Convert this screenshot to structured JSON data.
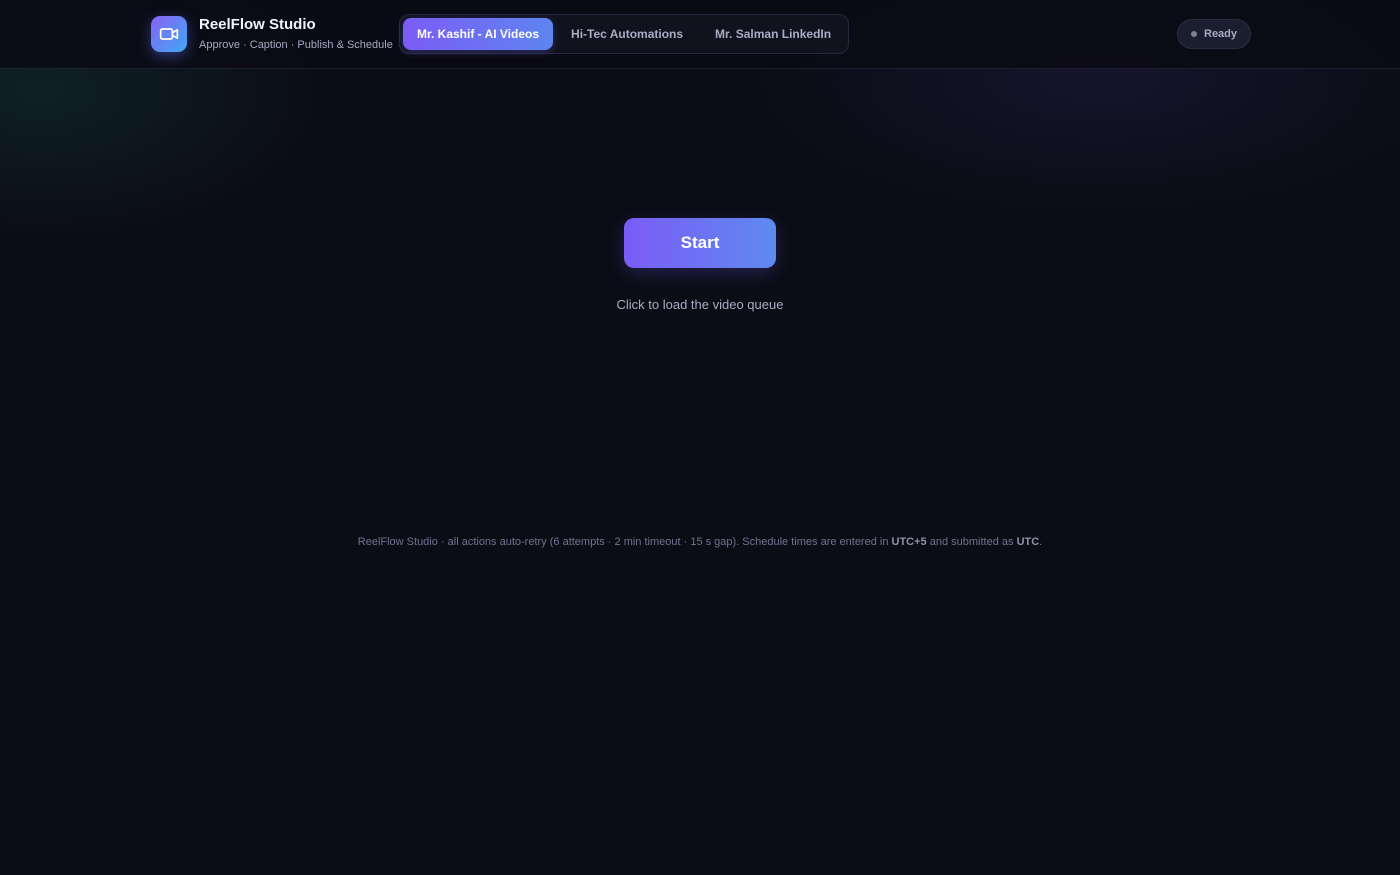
{
  "app": {
    "title": "ReelFlow Studio",
    "subtitle": "Approve · Caption · Publish & Schedule",
    "logo_icon": "video-camera-icon"
  },
  "tabs": [
    {
      "label": "Mr. Kashif - AI Videos",
      "active": true
    },
    {
      "label": "Hi-Tec Automations",
      "active": false
    },
    {
      "label": "Mr. Salman LinkedIn",
      "active": false
    }
  ],
  "status": {
    "label": "Ready"
  },
  "main": {
    "start_label": "Start",
    "hint": "Click to load the video queue"
  },
  "footer": {
    "text_before": "ReelFlow Studio · all actions auto-retry (6 attempts · 2 min timeout · 15 s gap). Schedule times are entered in ",
    "tz_local": "UTC+5",
    "text_middle": " and submitted as ",
    "tz_submit": "UTC",
    "text_after": "."
  },
  "colors": {
    "background": "#0b0c15",
    "accent_start": "#7a5cf6",
    "accent_end": "#5e8af0"
  }
}
